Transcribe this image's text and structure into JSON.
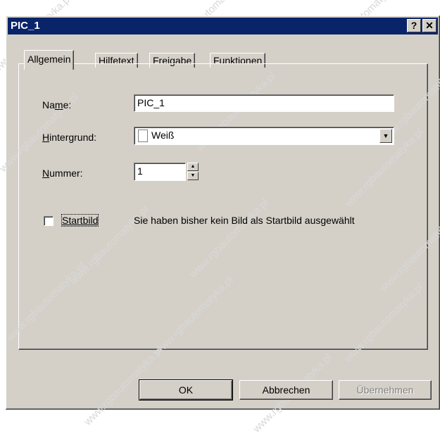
{
  "window": {
    "title": "PIC_1",
    "help_btn": "?",
    "close_btn": "✕"
  },
  "tabs": [
    {
      "label": "Allgemein",
      "active": true
    },
    {
      "label": "Hilfetext",
      "active": false
    },
    {
      "label": "Freigabe",
      "active": false
    },
    {
      "label": "Funktionen",
      "active": false
    }
  ],
  "form": {
    "name_label_pre": "Na",
    "name_label_u": "m",
    "name_label_post": "e:",
    "name_value": "PIC_1",
    "bg_label_u": "H",
    "bg_label_post": "intergrund:",
    "bg_value": "Weiß",
    "number_label_u": "N",
    "number_label_post": "ummer:",
    "number_value": "1",
    "startbild_label": "Startbild",
    "startbild_checked": false,
    "startbild_info": "Sie haben bisher kein Bild als Startbild ausgewählt"
  },
  "buttons": {
    "ok": "OK",
    "cancel": "Abbrechen",
    "apply": "Übernehmen"
  },
  "watermark": "www.rgbautomatyka.pl",
  "colors": {
    "titlebar": "#0a246a",
    "face": "#d4d0c8"
  }
}
